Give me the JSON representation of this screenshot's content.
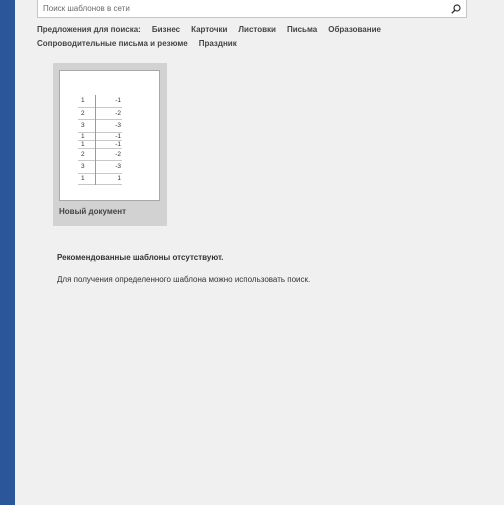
{
  "search": {
    "placeholder": "Поиск шаблонов в сети",
    "icon": "search-icon"
  },
  "suggestions": {
    "label": "Предложения для поиска:",
    "row1": [
      "Бизнес",
      "Карточки",
      "Листовки",
      "Письма",
      "Образование"
    ],
    "row2": [
      "Сопроводительные письма и резюме",
      "Праздник"
    ]
  },
  "tile": {
    "caption": "Новый документ",
    "rows": [
      [
        "1",
        "-1"
      ],
      [
        "2",
        "-2"
      ],
      [
        "3",
        "-3"
      ],
      [
        "1",
        "-1"
      ],
      [
        "1",
        "-1"
      ],
      [
        "2",
        "-2"
      ],
      [
        "3",
        "-3"
      ],
      [
        "1",
        "1"
      ]
    ]
  },
  "message": {
    "title": "Рекомендованные шаблоны отсутствуют.",
    "body": "Для получения определенного шаблона можно использовать поиск."
  },
  "colors": {
    "rail": "#2b579a",
    "background": "#f0f0f0",
    "tile": "#d2d2d2"
  }
}
